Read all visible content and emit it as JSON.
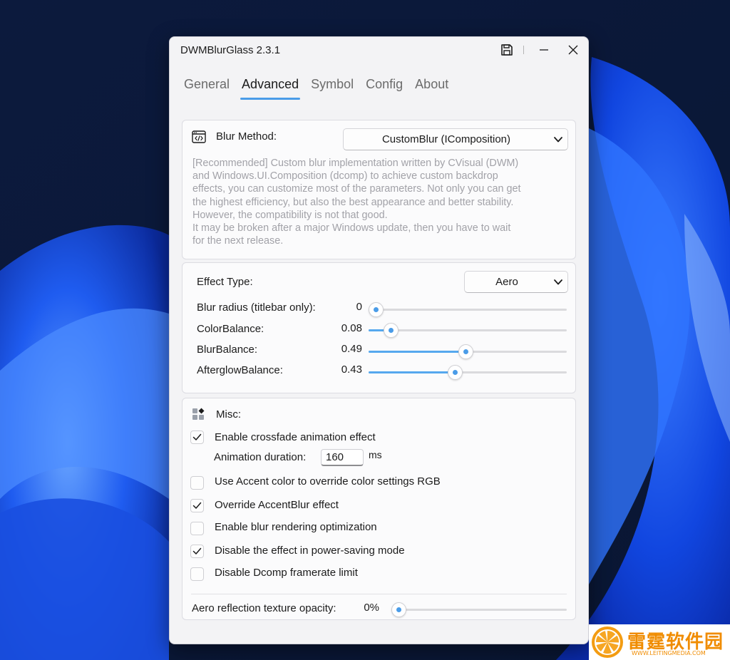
{
  "window": {
    "title": "DWMBlurGlass 2.3.1"
  },
  "tabs": [
    {
      "label": "General",
      "active": false
    },
    {
      "label": "Advanced",
      "active": true
    },
    {
      "label": "Symbol",
      "active": false
    },
    {
      "label": "Config",
      "active": false
    },
    {
      "label": "About",
      "active": false
    }
  ],
  "blur_method": {
    "label": "Blur Method:",
    "icon": "code-window-icon",
    "selected": "CustomBlur (IComposition)",
    "description_lines": [
      "[Recommended] Custom blur implementation written by CVisual (DWM)",
      "and Windows.UI.Composition (dcomp) to achieve custom backdrop",
      "effects, you can customize most of the parameters. Not only you can get",
      "the highest efficiency, but also the best appearance and better stability.",
      "However, the compatibility is not that good.",
      "It may be broken after a major Windows update, then you have to wait",
      "for the next release."
    ]
  },
  "effect": {
    "label": "Effect Type:",
    "selected": "Aero",
    "sliders": [
      {
        "label": "Blur radius (titlebar only):",
        "value": "0",
        "fraction": 0.0
      },
      {
        "label": "ColorBalance:",
        "value": "0.08",
        "fraction": 0.08
      },
      {
        "label": "BlurBalance:",
        "value": "0.49",
        "fraction": 0.49
      },
      {
        "label": "AfterglowBalance:",
        "value": "0.43",
        "fraction": 0.43
      }
    ]
  },
  "misc": {
    "label": "Misc:",
    "icon": "apps-grid-icon",
    "crossfade": {
      "label": "Enable crossfade animation effect",
      "checked": true
    },
    "animation_duration": {
      "label": "Animation duration:",
      "value": "160",
      "unit": "ms"
    },
    "options": [
      {
        "label": "Use Accent color to override color settings RGB",
        "checked": false
      },
      {
        "label": "Override AccentBlur effect",
        "checked": true
      },
      {
        "label": "Enable blur rendering optimization",
        "checked": false
      },
      {
        "label": "Disable the effect in power-saving mode",
        "checked": true
      },
      {
        "label": "Disable Dcomp framerate limit",
        "checked": false
      }
    ],
    "reflection": {
      "label": "Aero reflection texture opacity:",
      "value": "0%",
      "fraction": 0.0
    }
  },
  "watermark": {
    "text": "雷霆软件园",
    "sub": "WWW.LEITINGMEDIA.COM"
  },
  "colors": {
    "accent": "#4a9ce8",
    "window_bg": "#f3f3f5",
    "card_bg": "#fbfbfc",
    "muted_text": "#a2a2a8"
  }
}
